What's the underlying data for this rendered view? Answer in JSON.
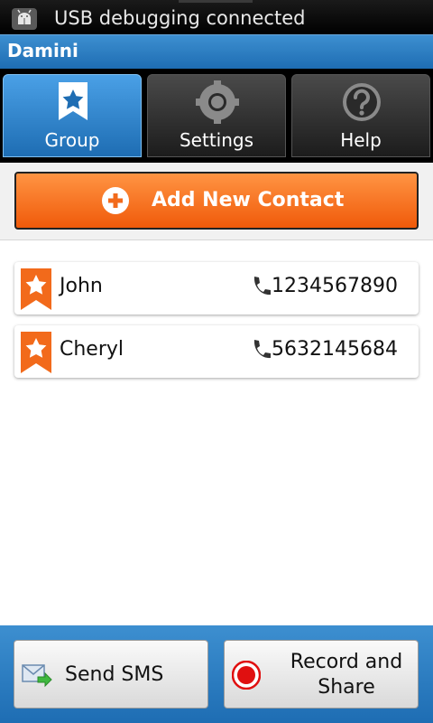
{
  "status_bar": {
    "text": "USB debugging connected"
  },
  "title_bar": {
    "title": "Damini"
  },
  "tabs": [
    {
      "label": "Group",
      "icon": "bookmark-star-icon",
      "active": true
    },
    {
      "label": "Settings",
      "icon": "gear-icon",
      "active": false
    },
    {
      "label": "Help",
      "icon": "question-icon",
      "active": false
    }
  ],
  "add_contact": {
    "label": "Add New Contact",
    "icon": "plus-circle-icon"
  },
  "contacts": [
    {
      "name": "John",
      "phone": "1234567890"
    },
    {
      "name": "Cheryl",
      "phone": "5632145684"
    }
  ],
  "bottom": {
    "send_sms": "Send SMS",
    "record_share": "Record and Share"
  },
  "colors": {
    "accent_blue": "#2a7dc4",
    "orange": "#f26a1b",
    "record_red": "#e01010"
  }
}
